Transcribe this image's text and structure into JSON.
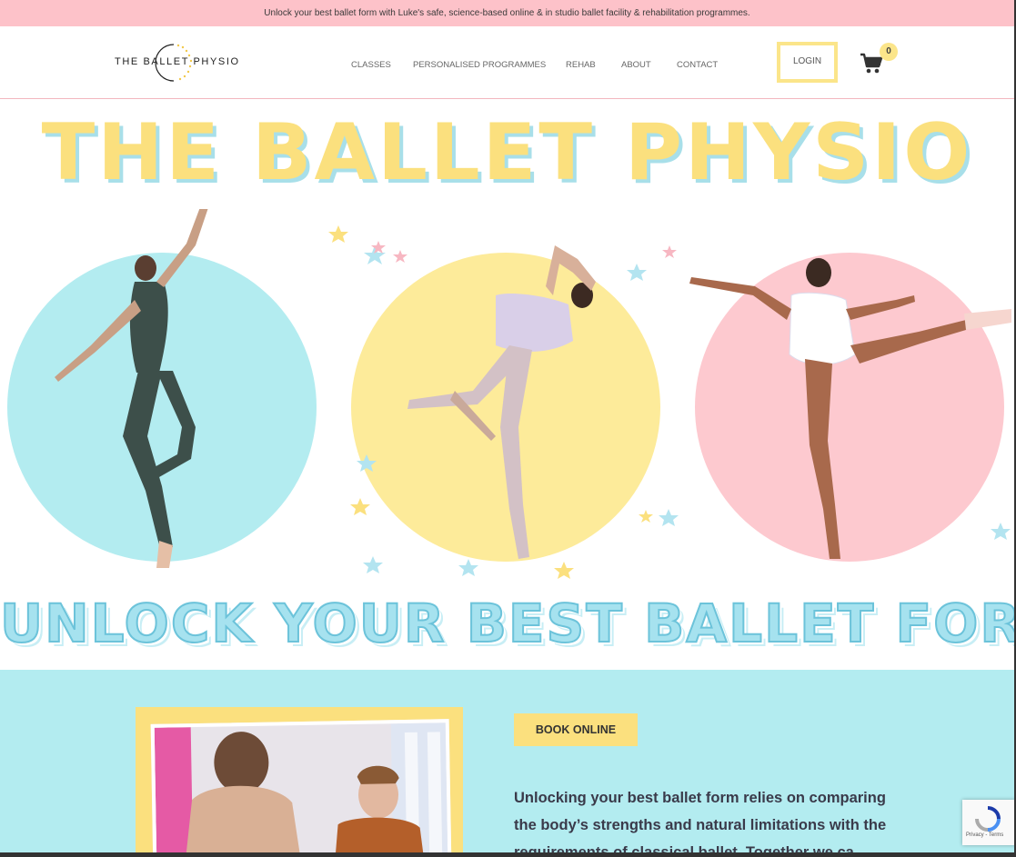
{
  "announcement": "Unlock your best ballet form with Luke's safe, science-based online & in studio ballet facility & rehabilitation programmes.",
  "logo": {
    "text": "THE BALLET PHYSIO"
  },
  "nav": {
    "items": [
      {
        "label": "CLASSES"
      },
      {
        "label": "PERSONALISED PROGRAMMES"
      },
      {
        "label": "REHAB"
      },
      {
        "label": "ABOUT"
      },
      {
        "label": "CONTACT"
      }
    ],
    "login_label": "LOGIN",
    "cart_count": "0"
  },
  "hero": {
    "title": "THE BALLET PHYSIO",
    "subtitle": "UNLOCK YOUR BEST BALLET FORM"
  },
  "about": {
    "book_label": "BOOK ONLINE",
    "text": "Unlocking your best ballet form relies on comparing the body’s strengths and natural limitations with the requirements of classical ballet. Together we ca"
  },
  "recaptcha": {
    "text": "Privacy - Terms"
  },
  "colors": {
    "pink": "#fdc2c9",
    "yellow": "#fbe07e",
    "blue": "#b3ecf0",
    "circle_blue": "#b3ecf0",
    "circle_yellow": "#fdeb9a",
    "circle_pink": "#fdc9cf"
  },
  "icons": {
    "cart": "shopping-cart-icon",
    "recaptcha": "recaptcha-icon"
  }
}
